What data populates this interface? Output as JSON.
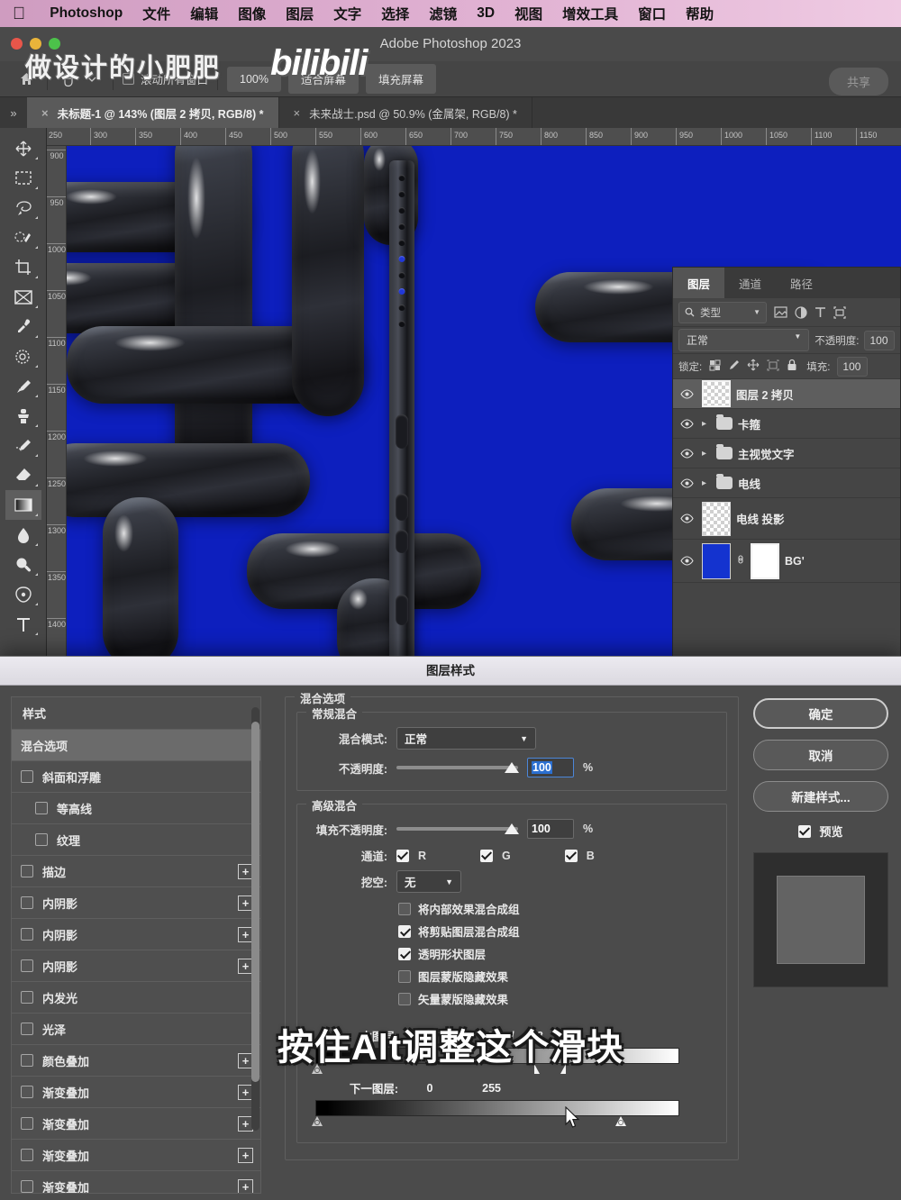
{
  "menubar": {
    "apple_icon": "apple-logo-icon",
    "items": [
      "Photoshop",
      "文件",
      "编辑",
      "图像",
      "图层",
      "文字",
      "选择",
      "滤镜",
      "3D",
      "视图",
      "增效工具",
      "窗口",
      "帮助"
    ]
  },
  "window": {
    "title": "Adobe Photoshop 2023"
  },
  "watermark": {
    "author": "做设计的小肥肥",
    "brand": "bilibili"
  },
  "options_bar": {
    "home_icon": "home-icon",
    "tool_icon": "hand-tool-icon",
    "dropdown_icon": "chevron-down-icon",
    "scroll_all_label": "滚动所有窗口",
    "scroll_all_checked": false,
    "buttons": [
      "100%",
      "适合屏幕",
      "填充屏幕"
    ],
    "share_label": "共享"
  },
  "tabs": {
    "overflow_icon": "chevron-double-right-icon",
    "items": [
      {
        "label": "未标题-1 @ 143% (图层 2 拷贝, RGB/8) *",
        "active": true
      },
      {
        "label": "未来战士.psd @ 50.9% (金属架, RGB/8) *",
        "active": false
      }
    ]
  },
  "toolbar": {
    "tools": [
      "move-tool-icon",
      "rectangular-marquee-tool-icon",
      "lasso-tool-icon",
      "quick-selection-tool-icon",
      "crop-tool-icon",
      "frame-tool-icon",
      "eyedropper-tool-icon",
      "spot-healing-brush-tool-icon",
      "brush-tool-icon",
      "clone-stamp-tool-icon",
      "history-brush-tool-icon",
      "eraser-tool-icon",
      "gradient-tool-icon",
      "blur-tool-icon",
      "dodge-tool-icon",
      "pen-tool-icon",
      "type-tool-icon"
    ],
    "selected": "gradient-tool-icon"
  },
  "rulers": {
    "horizontal": [
      "250",
      "300",
      "350",
      "400",
      "450",
      "500",
      "550",
      "600",
      "650",
      "700",
      "750",
      "800",
      "850",
      "900",
      "950",
      "1000",
      "1050",
      "1100",
      "1150"
    ],
    "vertical": [
      "900",
      "950",
      "1000",
      "1050",
      "1100",
      "1150",
      "1200",
      "1250",
      "1300",
      "1350",
      "1400"
    ]
  },
  "canvas": {
    "background_color": "#0d1fbe",
    "artwork_color": "#26282f"
  },
  "layers_panel": {
    "tabs": [
      {
        "label": "图层",
        "active": true
      },
      {
        "label": "通道",
        "active": false
      },
      {
        "label": "路径",
        "active": false
      }
    ],
    "filter": {
      "icon": "search-icon",
      "label": "类型",
      "chevron": "chevron-down-icon"
    },
    "filter_icons": [
      "image-filter-icon",
      "adjustment-filter-icon",
      "type-filter-icon",
      "shape-filter-icon"
    ],
    "blend_mode": "正常",
    "opacity_label": "不透明度:",
    "opacity_value": "100",
    "lock_label": "锁定:",
    "lock_icons": [
      "lock-transparency-icon",
      "lock-image-icon",
      "lock-position-icon",
      "lock-artboard-icon",
      "lock-all-icon"
    ],
    "fill_label": "填充:",
    "fill_value": "100",
    "layers": [
      {
        "name": "图层 2 拷贝",
        "type": "pixel",
        "visible": true,
        "selected": true,
        "thumb": "transparent"
      },
      {
        "name": "卡箍",
        "type": "group",
        "visible": true,
        "selected": false
      },
      {
        "name": "主视觉文字",
        "type": "group",
        "visible": true,
        "selected": false
      },
      {
        "name": "电线",
        "type": "group",
        "visible": true,
        "selected": false
      },
      {
        "name": "电线 投影",
        "type": "pixel",
        "visible": true,
        "selected": false,
        "thumb": "transparent"
      },
      {
        "name": "BG'",
        "type": "pixel",
        "visible": true,
        "selected": false,
        "thumb": "blue",
        "has_mask": true
      }
    ]
  },
  "dialog": {
    "title": "图层样式",
    "styles": {
      "header": "样式",
      "items": [
        {
          "label": "混合选项",
          "checkbox": false,
          "active": true,
          "indent": false,
          "plus": false
        },
        {
          "label": "斜面和浮雕",
          "checkbox": true,
          "checked": false,
          "active": false,
          "indent": false,
          "plus": false
        },
        {
          "label": "等高线",
          "checkbox": true,
          "checked": false,
          "active": false,
          "indent": true,
          "plus": false
        },
        {
          "label": "纹理",
          "checkbox": true,
          "checked": false,
          "active": false,
          "indent": true,
          "plus": false
        },
        {
          "label": "描边",
          "checkbox": true,
          "checked": false,
          "active": false,
          "indent": false,
          "plus": true
        },
        {
          "label": "内阴影",
          "checkbox": true,
          "checked": false,
          "active": false,
          "indent": false,
          "plus": true
        },
        {
          "label": "内阴影",
          "checkbox": true,
          "checked": false,
          "active": false,
          "indent": false,
          "plus": true
        },
        {
          "label": "内阴影",
          "checkbox": true,
          "checked": false,
          "active": false,
          "indent": false,
          "plus": true
        },
        {
          "label": "内发光",
          "checkbox": true,
          "checked": false,
          "active": false,
          "indent": false,
          "plus": false
        },
        {
          "label": "光泽",
          "checkbox": true,
          "checked": false,
          "active": false,
          "indent": false,
          "plus": false
        },
        {
          "label": "颜色叠加",
          "checkbox": true,
          "checked": false,
          "active": false,
          "indent": false,
          "plus": true
        },
        {
          "label": "渐变叠加",
          "checkbox": true,
          "checked": false,
          "active": false,
          "indent": false,
          "plus": true
        },
        {
          "label": "渐变叠加",
          "checkbox": true,
          "checked": false,
          "active": false,
          "indent": false,
          "plus": true
        },
        {
          "label": "渐变叠加",
          "checkbox": true,
          "checked": false,
          "active": false,
          "indent": false,
          "plus": true
        },
        {
          "label": "渐变叠加",
          "checkbox": true,
          "checked": false,
          "active": false,
          "indent": false,
          "plus": true
        }
      ]
    },
    "blending": {
      "section_label": "混合选项",
      "general": {
        "group_label": "常规混合",
        "mode_label": "混合模式:",
        "mode_value": "正常",
        "opacity_label": "不透明度:",
        "opacity_value": "100",
        "opacity_unit": "%"
      },
      "advanced": {
        "group_label": "高级混合",
        "fill_opacity_label": "填充不透明度:",
        "fill_opacity_value": "100",
        "fill_opacity_unit": "%",
        "channels_label": "通道:",
        "channels": [
          {
            "name": "R",
            "checked": true
          },
          {
            "name": "G",
            "checked": true
          },
          {
            "name": "B",
            "checked": true
          }
        ],
        "knockout_label": "挖空:",
        "knockout_value": "无",
        "checkboxes": [
          {
            "label": "将内部效果混合成组",
            "checked": false
          },
          {
            "label": "将剪贴图层混合成组",
            "checked": true
          },
          {
            "label": "透明形状图层",
            "checked": true
          },
          {
            "label": "图层蒙版隐藏效果",
            "checked": false
          },
          {
            "label": "矢量蒙版隐藏效果",
            "checked": false
          }
        ]
      },
      "blend_if": {
        "this_layer_label": "本图层:",
        "this_layer_min": "0",
        "this_layer_max_a": "179",
        "this_layer_sep": "/",
        "this_layer_max_b": "198",
        "underlying_label": "下一图层:",
        "underlying_min": "0",
        "underlying_max": "255"
      }
    },
    "buttons": {
      "ok": "确定",
      "cancel": "取消",
      "new_style": "新建样式...",
      "preview_label": "预览",
      "preview_checked": true
    }
  },
  "subtitle": {
    "text": "按住Alt调整这个滑块"
  }
}
